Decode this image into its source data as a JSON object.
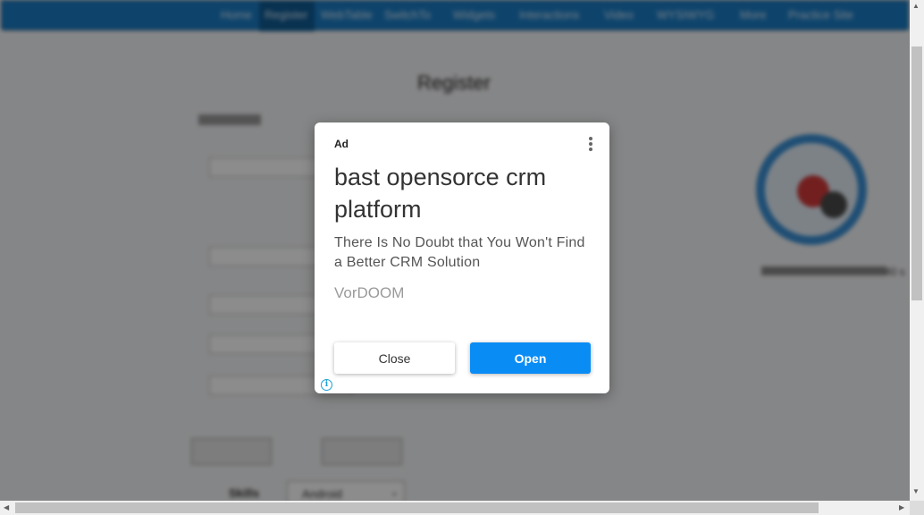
{
  "background_page": {
    "nav_items": [
      "Home",
      "Register",
      "WebTable",
      "SwitchTo",
      "Widgets",
      "Interactions",
      "Video",
      "WYSIWYG",
      "More",
      "Practice Site"
    ],
    "heading": "Register",
    "side_text": "40 s",
    "skills_label": "Skills",
    "skills_value": "Android"
  },
  "ad": {
    "label": "Ad",
    "title": "bast opensorce crm platform",
    "description": "There Is No Doubt that You Won't Find a Better CRM Solution",
    "brand": "VorDOOM",
    "close_label": "Close",
    "open_label": "Open",
    "info_glyph": "i",
    "open_color": "#0a8cf5",
    "info_color": "#1aa0d8"
  },
  "scrollbars": {
    "up_arrow": "▲",
    "down_arrow": "▼",
    "left_arrow": "◀",
    "right_arrow": "▶"
  }
}
